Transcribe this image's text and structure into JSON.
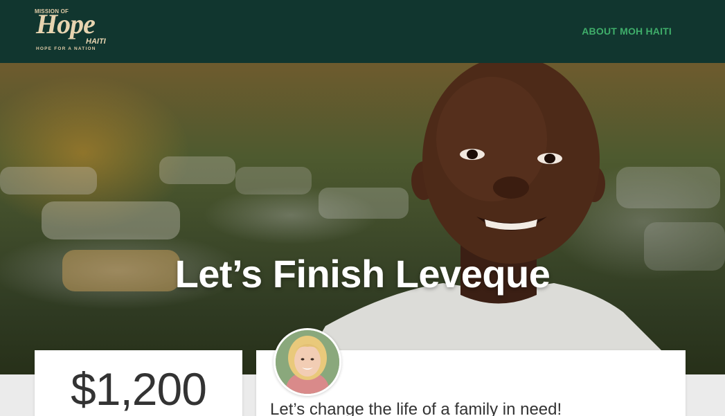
{
  "header": {
    "logo": {
      "line1": "MISSION OF",
      "line2": "Hope",
      "line3": "HAITI",
      "tagline": "HOPE FOR A NATION"
    },
    "nav": [
      {
        "label": "ABOUT MOH HAITI"
      }
    ],
    "nav_color": "#3fae6a",
    "bar_color": "#11362f"
  },
  "hero": {
    "title": "Let’s Finish Leveque"
  },
  "donation": {
    "amount": "$1,200"
  },
  "fundraiser": {
    "message": "Let’s change the life of a family in need!"
  }
}
